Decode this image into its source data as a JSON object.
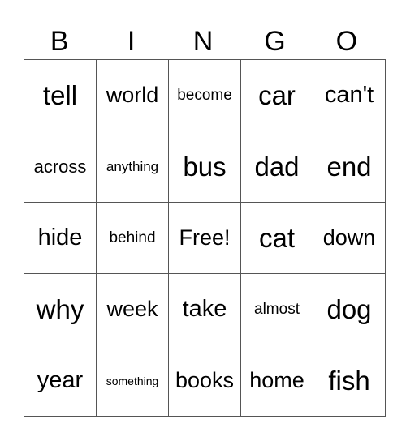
{
  "header": [
    "B",
    "I",
    "N",
    "G",
    "O"
  ],
  "rows": [
    [
      {
        "text": "tell",
        "size": "s36"
      },
      {
        "text": "world",
        "size": "s28"
      },
      {
        "text": "become",
        "size": "s20"
      },
      {
        "text": "car",
        "size": "s36"
      },
      {
        "text": "can't",
        "size": "s32"
      }
    ],
    [
      {
        "text": "across",
        "size": "s24"
      },
      {
        "text": "anything",
        "size": "s18"
      },
      {
        "text": "bus",
        "size": "s36"
      },
      {
        "text": "dad",
        "size": "s36"
      },
      {
        "text": "end",
        "size": "s36"
      }
    ],
    [
      {
        "text": "hide",
        "size": "s32"
      },
      {
        "text": "behind",
        "size": "s20"
      },
      {
        "text": "Free!",
        "size": "s28"
      },
      {
        "text": "cat",
        "size": "s36"
      },
      {
        "text": "down",
        "size": "s28"
      }
    ],
    [
      {
        "text": "why",
        "size": "s36"
      },
      {
        "text": "week",
        "size": "s28"
      },
      {
        "text": "take",
        "size": "s32"
      },
      {
        "text": "almost",
        "size": "s20"
      },
      {
        "text": "dog",
        "size": "s36"
      }
    ],
    [
      {
        "text": "year",
        "size": "s32"
      },
      {
        "text": "something",
        "size": "s15"
      },
      {
        "text": "books",
        "size": "s28"
      },
      {
        "text": "home",
        "size": "s28"
      },
      {
        "text": "fish",
        "size": "s36"
      }
    ]
  ]
}
